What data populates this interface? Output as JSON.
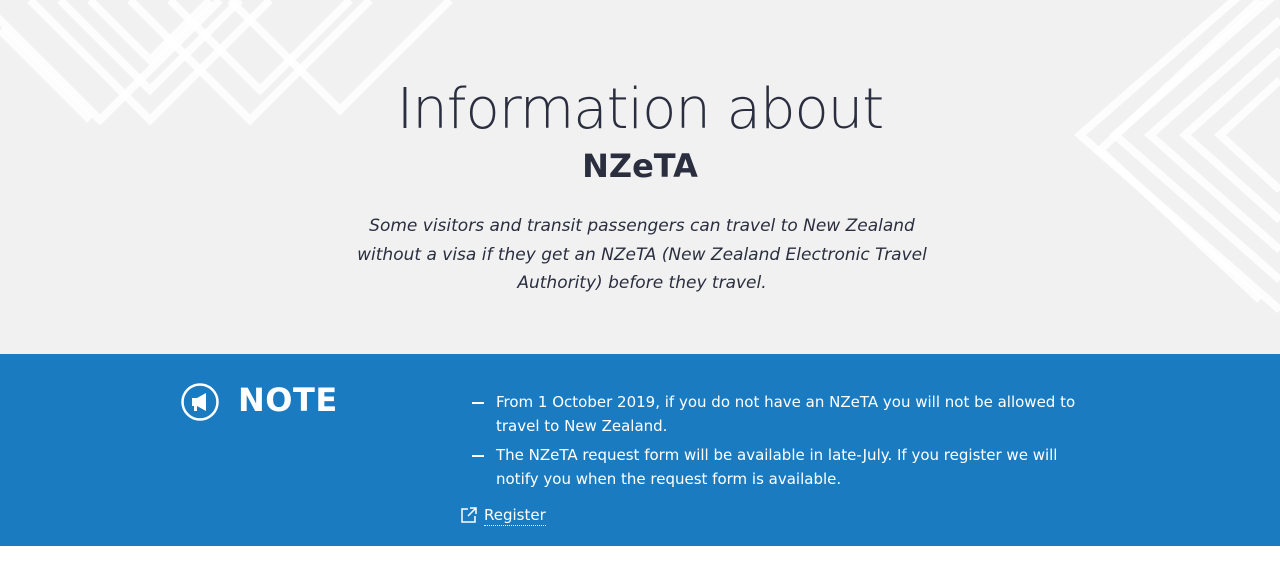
{
  "hero": {
    "title": "Information about",
    "subtitle": "NZeTA",
    "description": "Some visitors and transit passengers can travel to New Zealand without a visa if they get an NZeTA (New Zealand Electronic Travel Authority) before they travel."
  },
  "note": {
    "icon": "megaphone-icon",
    "heading": "NOTE",
    "items": [
      "From 1 October 2019, if you do not have an NZeTA you will not be allowed to travel to New Zealand.",
      "The NZeTA request form will be available in late-July. If you register we will notify you when the request form is available."
    ],
    "link": {
      "label": "Register",
      "icon": "external-link-icon"
    }
  },
  "colors": {
    "hero_background": "#f1f1f1",
    "note_background": "#1b7bc0",
    "heading_text": "#2a2e3f",
    "pattern_stripe": "#ffffff"
  }
}
